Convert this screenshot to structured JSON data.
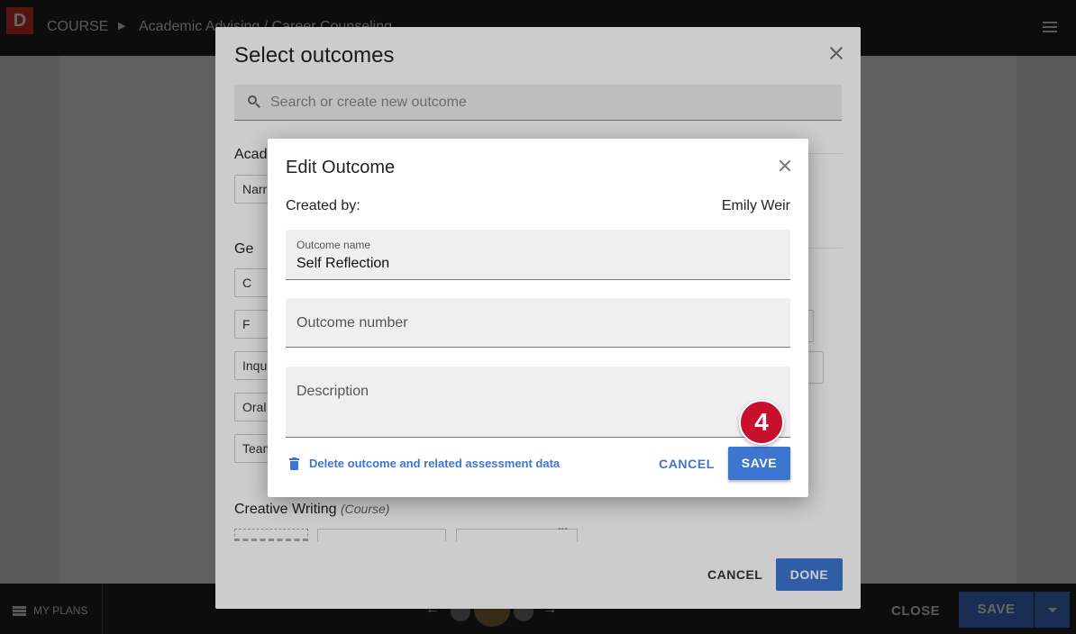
{
  "app": {
    "logo_letter": "D",
    "breadcrumb": {
      "course": "COURSE",
      "page": "Academic Advising / Career Counseling"
    },
    "bottom_bar": {
      "my_plans": "MY PLANS",
      "close": "CLOSE",
      "save": "SAVE"
    }
  },
  "select_dialog": {
    "title": "Select outcomes",
    "search_placeholder": "Search or create new outcome",
    "sections": [
      {
        "heading": "Acad",
        "chips": [
          "Narr"
        ]
      },
      {
        "heading": "Ge",
        "chips": [
          "C",
          "F",
          "Inqu",
          "Oral",
          "Team"
        ]
      },
      {
        "heading": "Creative Writing",
        "subtitle": "(Course)"
      }
    ],
    "ellipsis": "---",
    "cancel_label": "CANCEL",
    "done_label": "DONE"
  },
  "edit_dialog": {
    "title": "Edit Outcome",
    "created_by_label": "Created by:",
    "created_by_value": "Emily Weir",
    "name_label": "Outcome name",
    "name_value": "Self Reflection",
    "number_placeholder": "Outcome number",
    "description_placeholder": "Description",
    "delete_label": "Delete outcome and related assessment data",
    "cancel_label": "CANCEL",
    "save_label": "SAVE"
  },
  "step_badge": "4",
  "colors": {
    "accent": "#3d76d0",
    "logo": "#d9322b",
    "badge": "#c8102e"
  }
}
